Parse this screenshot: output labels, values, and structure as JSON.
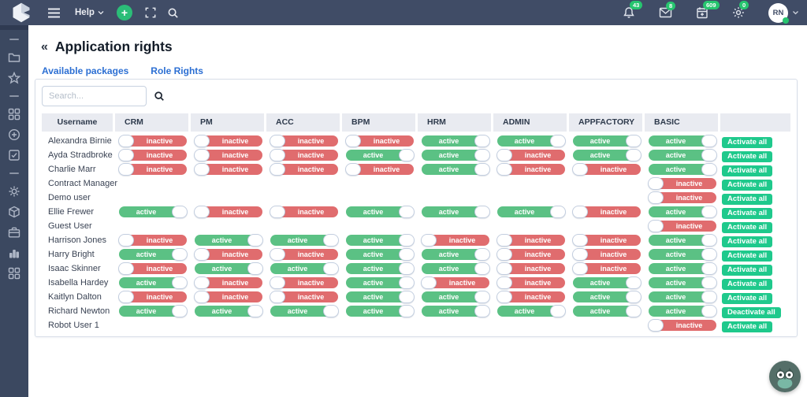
{
  "topbar": {
    "help_label": "Help",
    "plus_label": "+",
    "avatar_initials": "RN",
    "icons": [
      {
        "name": "notifications-bell-icon",
        "icon": "bell",
        "badge": "43"
      },
      {
        "name": "messages-envelope-icon",
        "icon": "envelope",
        "badge": "8"
      },
      {
        "name": "calendar-icon",
        "icon": "calendar",
        "badge": "609"
      },
      {
        "name": "settings-sun-icon",
        "icon": "sun",
        "badge": "0"
      }
    ]
  },
  "sidebar": {
    "items": [
      {
        "divider": true
      },
      {
        "name": "folder-icon",
        "icon": "folder"
      },
      {
        "name": "star-icon",
        "icon": "star"
      },
      {
        "divider": true
      },
      {
        "name": "apps-grid-icon",
        "icon": "grid"
      },
      {
        "name": "add-circle-icon",
        "icon": "circleplus"
      },
      {
        "name": "tasks-check-icon",
        "icon": "checksquare"
      },
      {
        "divider": true
      },
      {
        "name": "gear-icon",
        "icon": "gear"
      },
      {
        "name": "package-icon",
        "icon": "package"
      },
      {
        "name": "briefcase-icon",
        "icon": "briefcase"
      },
      {
        "name": "stats-chart-icon",
        "icon": "barchart"
      },
      {
        "name": "modules-grid-icon",
        "icon": "grid"
      }
    ]
  },
  "page": {
    "back_icon": "«",
    "title": "Application rights",
    "tabs": [
      {
        "label": "Available packages",
        "active": true
      },
      {
        "label": "Role Rights",
        "active": false
      }
    ]
  },
  "search": {
    "placeholder": "Search..."
  },
  "table": {
    "columns": [
      "Username",
      "CRM",
      "PM",
      "ACC",
      "BPM",
      "HRM",
      "ADMIN",
      "APPFACTORY",
      "BASIC",
      ""
    ],
    "toggle_labels": {
      "active": "active",
      "inactive": "inactive"
    },
    "rows": [
      {
        "username": "Alexandra Birnie",
        "toggles": [
          "inactive",
          "inactive",
          "inactive",
          "inactive",
          "active",
          "active",
          "active",
          "active"
        ],
        "action": "Activate all"
      },
      {
        "username": "Ayda Stradbroke",
        "toggles": [
          "inactive",
          "inactive",
          "inactive",
          "active",
          "active",
          "inactive",
          "active",
          "active"
        ],
        "action": "Activate all"
      },
      {
        "username": "Charlie Marr",
        "toggles": [
          "inactive",
          "inactive",
          "inactive",
          "inactive",
          "active",
          "inactive",
          "inactive",
          "active"
        ],
        "action": "Activate all"
      },
      {
        "username": "Contract Manager",
        "toggles": [
          null,
          null,
          null,
          null,
          null,
          null,
          null,
          "inactive"
        ],
        "action": "Activate all"
      },
      {
        "username": "Demo user",
        "toggles": [
          null,
          null,
          null,
          null,
          null,
          null,
          null,
          "inactive"
        ],
        "action": "Activate all"
      },
      {
        "username": "Ellie Frewer",
        "toggles": [
          "active",
          "inactive",
          "inactive",
          "active",
          "active",
          "active",
          "inactive",
          "active"
        ],
        "action": "Activate all"
      },
      {
        "username": "Guest User",
        "toggles": [
          null,
          null,
          null,
          null,
          null,
          null,
          null,
          "inactive"
        ],
        "action": "Activate all"
      },
      {
        "username": "Harrison Jones",
        "toggles": [
          "inactive",
          "active",
          "active",
          "active",
          "inactive",
          "inactive",
          "inactive",
          "active"
        ],
        "action": "Activate all"
      },
      {
        "username": "Harry Bright",
        "toggles": [
          "active",
          "inactive",
          "inactive",
          "active",
          "active",
          "inactive",
          "inactive",
          "active"
        ],
        "action": "Activate all"
      },
      {
        "username": "Isaac Skinner",
        "toggles": [
          "inactive",
          "active",
          "active",
          "active",
          "active",
          "inactive",
          "inactive",
          "active"
        ],
        "action": "Activate all"
      },
      {
        "username": "Isabella Hardey",
        "toggles": [
          "active",
          "inactive",
          "inactive",
          "active",
          "inactive",
          "inactive",
          "active",
          "active"
        ],
        "action": "Activate all"
      },
      {
        "username": "Kaitlyn Dalton",
        "toggles": [
          "inactive",
          "inactive",
          "inactive",
          "active",
          "active",
          "inactive",
          "active",
          "active"
        ],
        "action": "Activate all"
      },
      {
        "username": "Richard Newton",
        "toggles": [
          "active",
          "active",
          "active",
          "active",
          "active",
          "active",
          "active",
          "active"
        ],
        "action": "Deactivate all"
      },
      {
        "username": "Robot User 1",
        "toggles": [
          null,
          null,
          null,
          null,
          null,
          null,
          null,
          "inactive"
        ],
        "action": "Activate all"
      }
    ]
  },
  "colors": {
    "topbar_bg": "#404c66",
    "sidebar_bg": "#3b4860",
    "tab_blue": "#2c6fd3",
    "toggle_active_green": "#5bc184",
    "toggle_inactive_red": "#e06c6e",
    "action_button_green": "#1fc98c",
    "badge_green": "#27c56f",
    "header_cell_bg": "#e9ebf1"
  }
}
